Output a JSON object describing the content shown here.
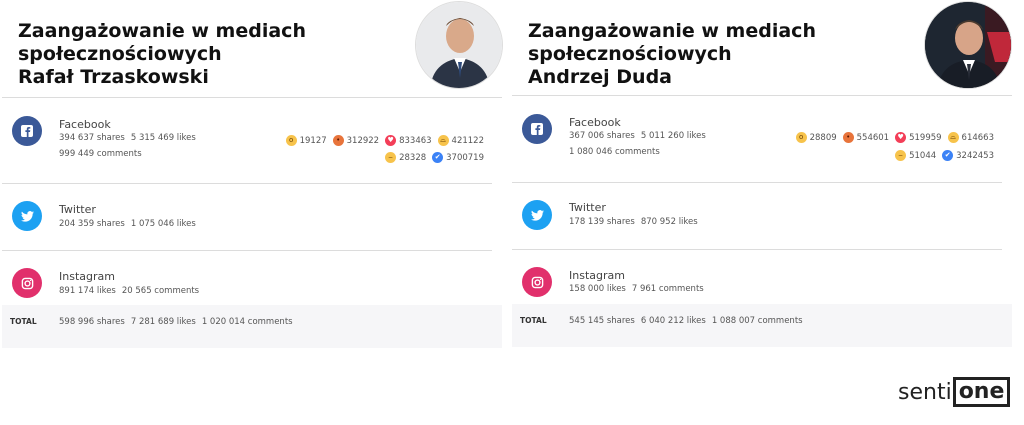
{
  "panels": [
    {
      "title_line1": "Zaangażowanie w mediach",
      "title_line2": "społecznościowych",
      "title_line3": "Rafał Trzaskowski",
      "facebook": {
        "name": "Facebook",
        "shares": "394 637 shares",
        "likes": "5 315 469 likes",
        "comments": "999 449 comments",
        "reactions_row1": [
          {
            "icon": "wow-icon",
            "value": "19127"
          },
          {
            "icon": "angry-icon",
            "value": "312922"
          },
          {
            "icon": "love-icon",
            "value": "833463"
          },
          {
            "icon": "haha-icon",
            "value": "421122"
          }
        ],
        "reactions_row2": [
          {
            "icon": "sad-icon",
            "value": "28328"
          },
          {
            "icon": "like-icon",
            "value": "3700719"
          }
        ]
      },
      "twitter": {
        "name": "Twitter",
        "shares": "204 359 shares",
        "likes": "1 075 046 likes"
      },
      "instagram": {
        "name": "Instagram",
        "likes": "891 174 likes",
        "comments": "20 565 comments"
      },
      "total": {
        "label": "TOTAL",
        "shares": "598 996 shares",
        "likes": "7 281 689 likes",
        "comments": "1 020 014 comments"
      }
    },
    {
      "title_line1": "Zaangażowanie w mediach",
      "title_line2": "społecznościowych",
      "title_line3": "Andrzej Duda",
      "facebook": {
        "name": "Facebook",
        "shares": "367 006 shares",
        "likes": "5 011 260 likes",
        "comments": "1 080 046 comments",
        "reactions_row1": [
          {
            "icon": "wow-icon",
            "value": "28809"
          },
          {
            "icon": "angry-icon",
            "value": "554601"
          },
          {
            "icon": "love-icon",
            "value": "519959"
          },
          {
            "icon": "haha-icon",
            "value": "614663"
          }
        ],
        "reactions_row2": [
          {
            "icon": "sad-icon",
            "value": "51044"
          },
          {
            "icon": "like-icon",
            "value": "3242453"
          }
        ]
      },
      "twitter": {
        "name": "Twitter",
        "shares": "178 139 shares",
        "likes": "870 952 likes"
      },
      "instagram": {
        "name": "Instagram",
        "likes": "158 000 likes",
        "comments": "7 961 comments"
      },
      "total": {
        "label": "TOTAL",
        "shares": "545 145 shares",
        "likes": "6 040 212 likes",
        "comments": "1 088 007 comments"
      }
    }
  ],
  "logo": {
    "text_left": "senti",
    "text_boxed": "one"
  },
  "colors": {
    "facebook": "#3b5998",
    "twitter": "#1da1f2",
    "instagram": "#e1306c",
    "total_bg": "#f6f6f8"
  }
}
